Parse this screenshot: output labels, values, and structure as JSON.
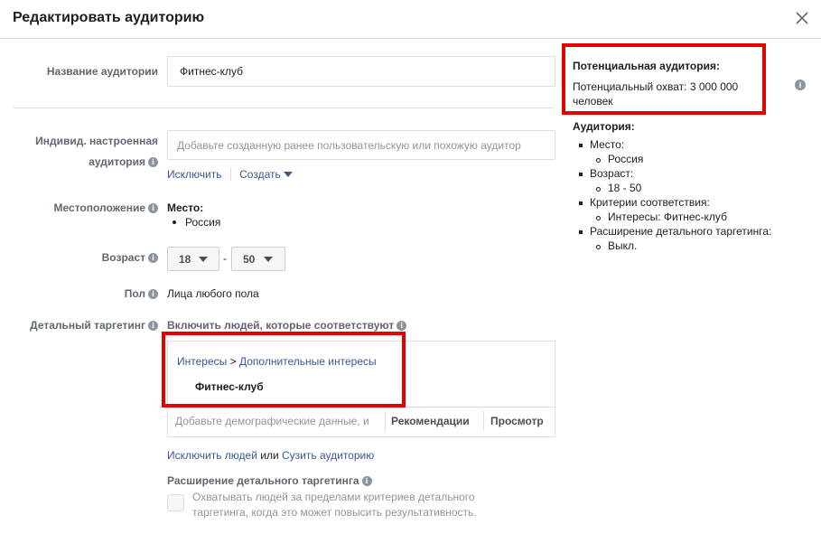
{
  "header": {
    "title": "Редактировать аудиторию"
  },
  "audience_name": {
    "label": "Название аудитории",
    "value": "Фитнес-клуб"
  },
  "custom_audience": {
    "label_line1": "Индивид. настроенная",
    "label_line2": "аудитория",
    "placeholder": "Добавьте созданную ранее пользовательскую или похожую аудитор",
    "exclude_link": "Исключить",
    "create_link": "Создать"
  },
  "location": {
    "label": "Местоположение",
    "heading": "Место:",
    "items": [
      "Россия"
    ]
  },
  "age": {
    "label": "Возраст",
    "from": "18",
    "separator": "-",
    "to": "50"
  },
  "gender": {
    "label": "Пол",
    "value": "Лица любого пола"
  },
  "detailed_targeting": {
    "label": "Детальный таргетинг",
    "include_text": "Включить людей, которые соответствуют",
    "breadcrumb_part1": "Интересы",
    "breadcrumb_sep": ">",
    "breadcrumb_part2": "Дополнительные интересы",
    "selected_item": "Фитнес-клуб",
    "search_placeholder": "Добавьте демографические данные, и",
    "recommendations": "Рекомендации",
    "browse": "Просмотр",
    "exclude_people": "Исключить людей",
    "or": "или",
    "narrow": "Сузить аудиторию"
  },
  "expansion": {
    "title": "Расширение детального таргетинга",
    "line1": "Охватывать людей за пределами критериев детального",
    "line2": "таргетинга, когда это может повысить результативность."
  },
  "sidebar": {
    "potential_title": "Потенциальная аудитория:",
    "reach_line1": "Потенциальный охват: 3 000 000",
    "reach_line2": "человек",
    "audience_title": "Аудитория:",
    "place_label": "Место:",
    "place_value": "Россия",
    "age_label": "Возраст:",
    "age_value": "18 - 50",
    "criteria_label": "Критерии соответствия:",
    "criteria_value": "Интересы: Фитнес-клуб",
    "expansion_label": "Расширение детального таргетинга:",
    "expansion_value": "Выкл."
  },
  "colors": {
    "highlight": "#e50000",
    "link": "#385898"
  }
}
